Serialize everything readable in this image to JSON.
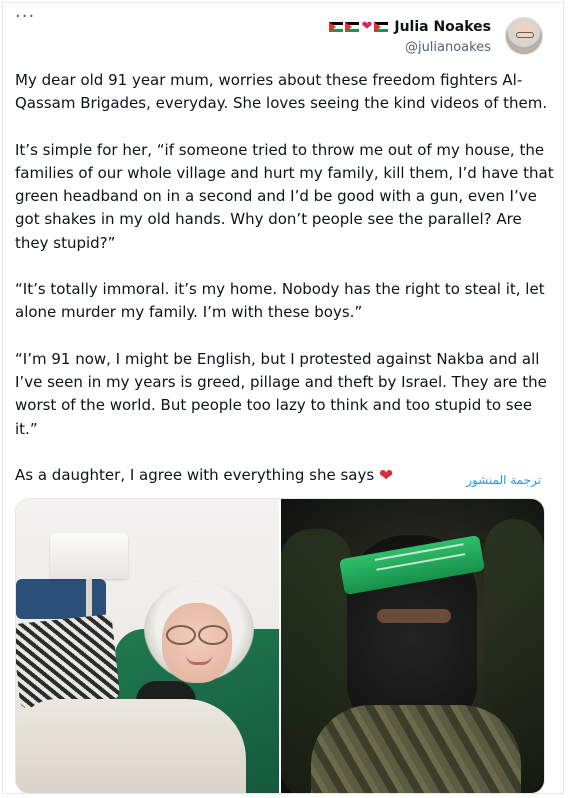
{
  "header": {
    "more_label": "···",
    "display_name": "Julia Noakes",
    "handle": "@julianoakes",
    "name_emojis": [
      "palestine-flag-icon",
      "palestine-flag-icon",
      "red-heart-icon",
      "palestine-flag-icon"
    ]
  },
  "tweet": {
    "paragraphs": [
      "My dear old 91 year mum, worries about these freedom fighters Al-Qassam Brigades, everyday. She loves seeing the kind videos of them.",
      "It’s simple for her, “if someone tried to throw me out of my house, the families of  our whole village  and hurt my family, kill them, I’d have that green headband on in a second and I’d be good with a gun, even I’ve got shakes in my old hands. Why don’t people see the parallel? Are they stupid?”",
      "“It’s totally immoral. it’s my home. Nobody has the right to steal it, let alone murder my family. I’m with these boys.”",
      "“I’m 91 now, I might be English, but I protested  against Nakba and all I’ve seen in my years is greed, pillage and theft by Israel. They are the worst of the world. But people too lazy to think and too stupid to see it.”",
      "As a daughter, I agree with everything she says"
    ],
    "closing_emoji": "red-heart-icon",
    "translate_label": "ترجمة المنشور"
  },
  "colors": {
    "text": "#0f1419",
    "secondary": "#536471",
    "link": "#1d9bf0",
    "heart": "#d32f3c"
  }
}
